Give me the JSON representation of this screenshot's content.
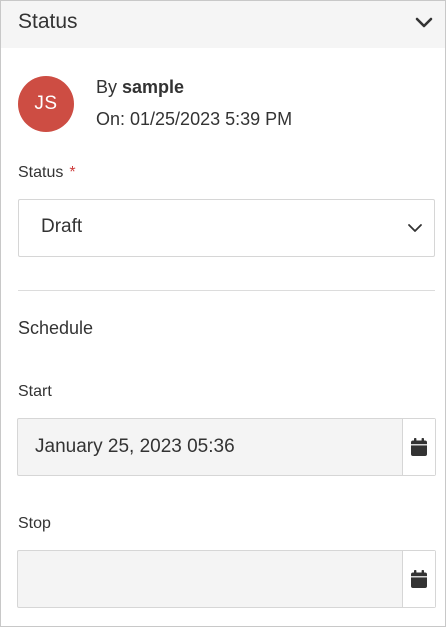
{
  "header": {
    "title": "Status"
  },
  "author": {
    "initials": "JS",
    "by_prefix": "By",
    "username": "sample",
    "on_text": "On: 01/25/2023 5:39 PM"
  },
  "status_field": {
    "label": "Status",
    "required_mark": "*",
    "selected_value": "Draft"
  },
  "schedule": {
    "title": "Schedule",
    "start_label": "Start",
    "start_value": "January 25, 2023 05:36",
    "stop_label": "Stop",
    "stop_value": ""
  },
  "colors": {
    "avatar_bg": "#cd4d43",
    "required": "#cd3b3b",
    "header_bg": "#f5f5f5",
    "readonly_field_bg": "#f4f4f4"
  },
  "icons": {
    "collapse": "chevron-down-icon",
    "select": "chevron-down-icon",
    "calendar": "calendar-icon"
  }
}
